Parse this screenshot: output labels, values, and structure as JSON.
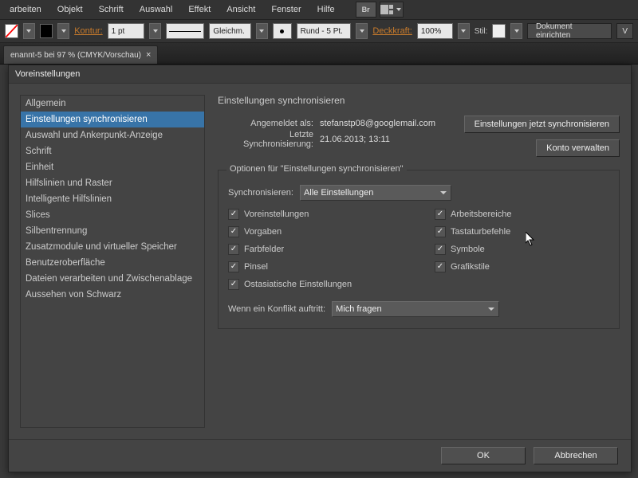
{
  "menu": [
    "arbeiten",
    "Objekt",
    "Schrift",
    "Auswahl",
    "Effekt",
    "Ansicht",
    "Fenster",
    "Hilfe"
  ],
  "bridge": "Br",
  "optbar": {
    "kontur_label": "Kontur:",
    "kontur_val": "1 pt",
    "strich_label": "Gleichm.",
    "cap_label": "Rund - 5 Pt.",
    "deckkraft_label": "Deckkraft:",
    "deckkraft_val": "100%",
    "stil_label": "Stil:",
    "doc_btn": "Dokument einrichten",
    "vref": "V"
  },
  "tab": {
    "label": "enannt-5 bei 97 % (CMYK/Vorschau)"
  },
  "modal": {
    "title": "Voreinstellungen",
    "sidebar": [
      "Allgemein",
      "Einstellungen synchronisieren",
      "Auswahl und Ankerpunkt-Anzeige",
      "Schrift",
      "Einheit",
      "Hilfslinien und Raster",
      "Intelligente Hilfslinien",
      "Slices",
      "Silbentrennung",
      "Zusatzmodule und virtueller Speicher",
      "Benutzeroberfläche",
      "Dateien verarbeiten und Zwischenablage",
      "Aussehen von Schwarz"
    ],
    "sel_index": 1,
    "panel_title": "Einstellungen synchronisieren",
    "signed_label": "Angemeldet als:",
    "signed_val": "stefanstp08@googlemail.com",
    "last_label": "Letzte Synchronisierung:",
    "last_val": "21.06.2013; 13:11",
    "sync_now_btn": "Einstellungen jetzt synchronisieren",
    "manage_btn": "Konto verwalten",
    "group_title": "Optionen für \"Einstellungen synchronisieren\"",
    "sync_label": "Synchronisieren:",
    "sync_select": "Alle Einstellungen",
    "checks": [
      {
        "label": "Voreinstellungen",
        "checked": true
      },
      {
        "label": "Arbeitsbereiche",
        "checked": true
      },
      {
        "label": "Vorgaben",
        "checked": true
      },
      {
        "label": "Tastaturbefehle",
        "checked": true
      },
      {
        "label": "Farbfelder",
        "checked": true
      },
      {
        "label": "Symbole",
        "checked": true
      },
      {
        "label": "Pinsel",
        "checked": true
      },
      {
        "label": "Grafikstile",
        "checked": true
      }
    ],
    "ost_check": {
      "label": "Ostasiatische Einstellungen",
      "checked": true
    },
    "conflict_label": "Wenn ein Konflikt auftritt:",
    "conflict_select": "Mich fragen",
    "ok": "OK",
    "cancel": "Abbrechen"
  }
}
